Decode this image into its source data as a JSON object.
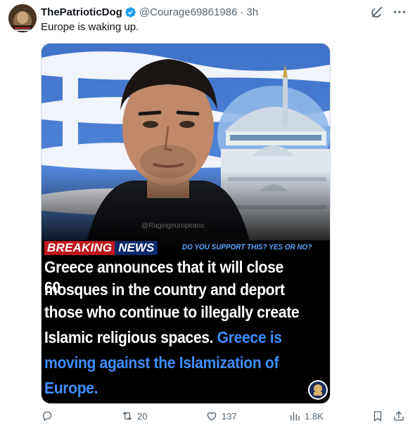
{
  "author": {
    "display_name": "ThePatrioticDog",
    "handle": "@Courage69861986",
    "separator": "·",
    "time": "3h",
    "verified": true
  },
  "tweet": {
    "text": "Europe is waking up."
  },
  "media": {
    "watermark": "@Ragingeuropeans",
    "banner": {
      "breaking": "BREAKING",
      "news": "NEWS",
      "question": "DO YOU SUPPORT THIS? YES OR NO?"
    },
    "headline_lines_white": [
      "Greece announces that it will close 60",
      "mosques in the country and deport",
      "those who continue to illegally create",
      "Islamic religious spaces."
    ],
    "headline_blue_inline": "Greece is",
    "headline_lines_blue": [
      "moving against the Islamization of",
      "Europe."
    ]
  },
  "actions": {
    "reply": "",
    "retweet": "20",
    "like": "137",
    "views": "1.8K"
  },
  "icons": {
    "verified": "verified-badge-icon",
    "grok": "grok-icon",
    "more": "more-icon",
    "reply": "reply-icon",
    "retweet": "retweet-icon",
    "like": "like-icon",
    "views": "views-icon",
    "bookmark": "bookmark-icon",
    "share": "share-icon"
  },
  "colors": {
    "verified_blue": "#1d9bf0",
    "muted": "#536471",
    "breaking_red": "#c0161c",
    "news_navy": "#0a2a6b",
    "headline_blue": "#3f8dff"
  }
}
